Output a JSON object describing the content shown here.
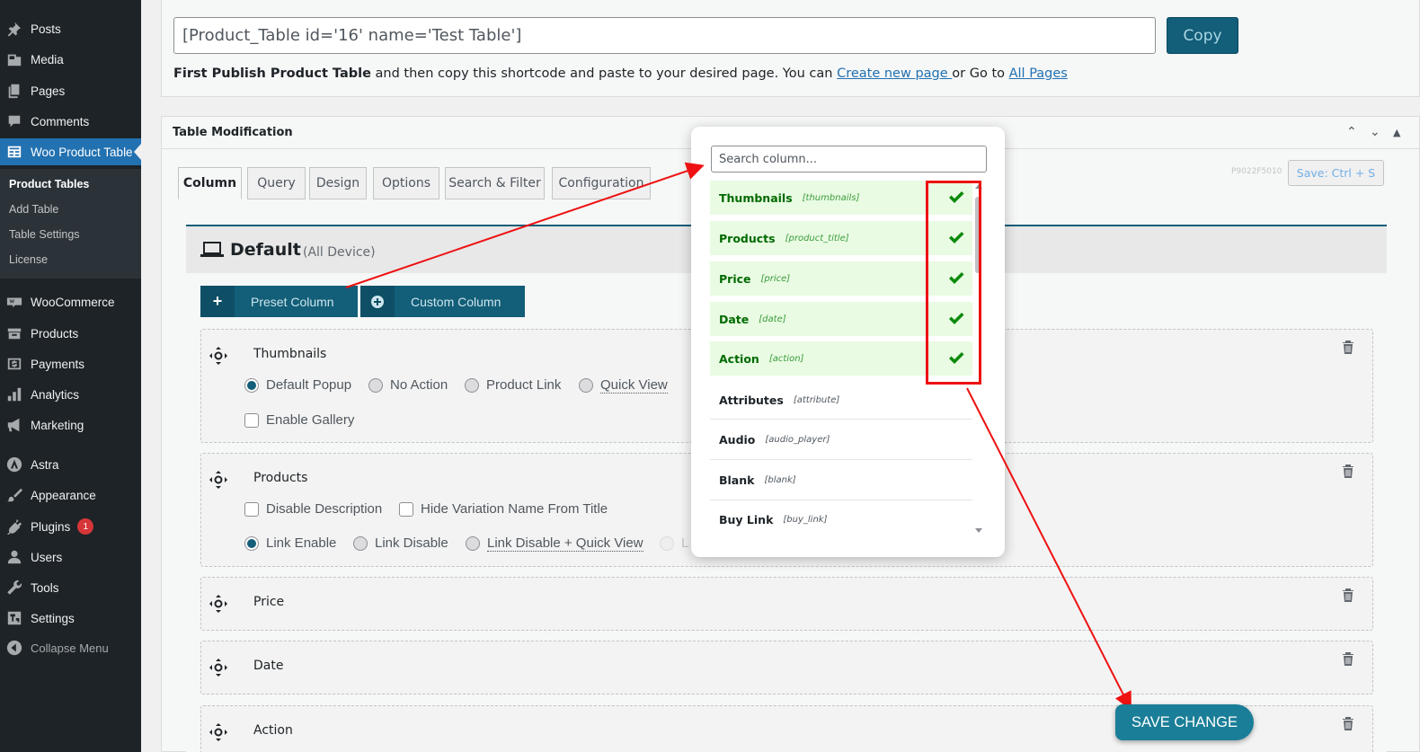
{
  "sidebar": {
    "items": [
      {
        "label": "Posts",
        "icon": "pin-icon"
      },
      {
        "label": "Media",
        "icon": "media-icon"
      },
      {
        "label": "Pages",
        "icon": "pages-icon"
      },
      {
        "label": "Comments",
        "icon": "comment-icon"
      },
      {
        "label": "Woo Product Table",
        "icon": "table-icon"
      },
      {
        "label": "WooCommerce",
        "icon": "woo-icon"
      },
      {
        "label": "Products",
        "icon": "archive-icon"
      },
      {
        "label": "Payments",
        "icon": "dollar-icon"
      },
      {
        "label": "Analytics",
        "icon": "chart-icon"
      },
      {
        "label": "Marketing",
        "icon": "megaphone-icon"
      },
      {
        "label": "Astra",
        "icon": "astra-icon"
      },
      {
        "label": "Appearance",
        "icon": "brush-icon"
      },
      {
        "label": "Plugins",
        "icon": "plugin-icon",
        "badge": "1"
      },
      {
        "label": "Users",
        "icon": "user-icon"
      },
      {
        "label": "Tools",
        "icon": "wrench-icon"
      },
      {
        "label": "Settings",
        "icon": "settings-icon"
      },
      {
        "label": "Collapse Menu",
        "icon": "collapse-icon"
      }
    ],
    "submenu": [
      "Product Tables",
      "Add Table",
      "Table Settings",
      "License"
    ]
  },
  "shortcode": {
    "value": "[Product_Table id='16' name='Test Table']",
    "copy_label": "Copy",
    "help_bold": "First Publish Product Table",
    "help_text": " and then copy this shortcode and paste to your desired page. You can ",
    "link_new": "Create new page ",
    "help_or": "or Go to ",
    "link_all": "All Pages"
  },
  "panel": {
    "title": "Table Modification",
    "tabs": [
      "Column",
      "Query",
      "Design",
      "Options",
      "Search & Filter",
      "Configuration"
    ],
    "version": "P9022F5010",
    "save_shortcut": "Save: Ctrl + S"
  },
  "default": {
    "title": "Default",
    "subtitle": "(All Device)",
    "preset_label": "Preset Column",
    "custom_label": "Custom Column"
  },
  "cards": {
    "thumbnails": {
      "title": "Thumbnails",
      "opts": [
        "Default Popup",
        "No Action",
        "Product Link",
        "Quick View"
      ],
      "gallery": "Enable Gallery"
    },
    "products": {
      "title": "Products",
      "checks": [
        "Disable Description",
        "Hide Variation Name From Title"
      ],
      "opts": [
        "Link Enable",
        "Link Disable",
        "Link Disable + Quick View",
        "L"
      ]
    },
    "price": "Price",
    "date": "Date",
    "action": "Action"
  },
  "popup": {
    "search_placeholder": "Search column...",
    "columns": [
      {
        "name": "Thumbnails",
        "key": "[thumbnails]",
        "checked": true
      },
      {
        "name": "Products",
        "key": "[product_title]",
        "checked": true
      },
      {
        "name": "Price",
        "key": "[price]",
        "checked": true
      },
      {
        "name": "Date",
        "key": "[date]",
        "checked": true
      },
      {
        "name": "Action",
        "key": "[action]",
        "checked": true
      },
      {
        "name": "Attributes",
        "key": "[attribute]",
        "checked": false
      },
      {
        "name": "Audio",
        "key": "[audio_player]",
        "checked": false
      },
      {
        "name": "Blank",
        "key": "[blank]",
        "checked": false
      },
      {
        "name": "Buy Link",
        "key": "[buy_link]",
        "checked": false
      }
    ]
  },
  "save_change": "SAVE CHANGE",
  "colors": {
    "accent": "#135e78",
    "highlight": "#ee1111",
    "checked_bg": "#e9fbe3",
    "check_green": "#0a8a0a"
  }
}
